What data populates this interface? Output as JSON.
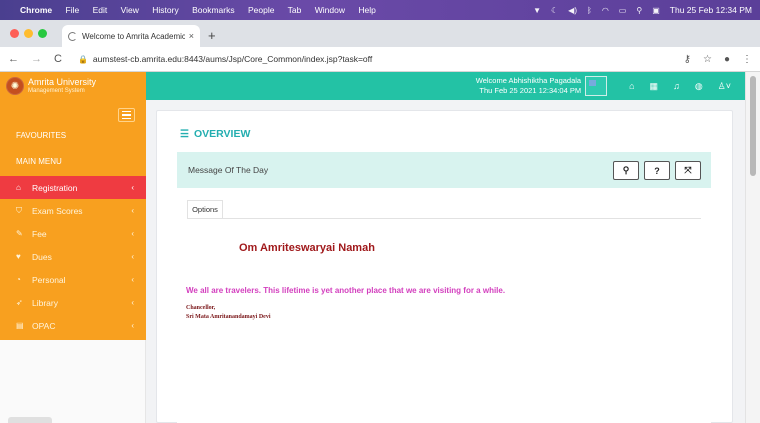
{
  "mac_menu": {
    "app": "Chrome",
    "items": [
      "File",
      "Edit",
      "View",
      "History",
      "Bookmarks",
      "People",
      "Tab",
      "Window",
      "Help"
    ],
    "clock": "Thu 25 Feb  12:34 PM"
  },
  "browser": {
    "tab_title": "Welcome to Amrita Academic I",
    "tab_close": "×",
    "new_tab": "+",
    "url": "aumstest-cb.amrita.edu:8443/aums/Jsp/Core_Common/index.jsp?task=off"
  },
  "app": {
    "logo_title": "Amrita University",
    "logo_subtitle": "Management System",
    "welcome_line": "Welcome Abhishiktha Pagadala",
    "datetime_line": "Thu Feb 25 2021 12:34:04 PM"
  },
  "sidebar": {
    "favourites": "FAVOURITES",
    "main_menu": "MAIN MENU",
    "items": [
      {
        "label": "Registration",
        "icon": "home-icon"
      },
      {
        "label": "Exam Scores",
        "icon": "cart-icon"
      },
      {
        "label": "Fee",
        "icon": "pencil-icon"
      },
      {
        "label": "Dues",
        "icon": "heart-icon"
      },
      {
        "label": "Personal",
        "icon": "clock-icon"
      },
      {
        "label": "Library",
        "icon": "send-icon"
      },
      {
        "label": "OPAC",
        "icon": "calendar-icon"
      }
    ]
  },
  "main": {
    "overview_title": "OVERVIEW",
    "panel_title": "Message Of The Day",
    "panel_buttons": {
      "link": "⚲",
      "help": "?",
      "expand": "⤧"
    },
    "options_tab": "Options",
    "om": "Om Amriteswaryai Namah",
    "quote": "We all are travelers. This lifetime is yet another place that we are visiting for a while.",
    "signature_title": "Chancellor,",
    "signature_name": "Sri Mata Amritanandamayi Devi"
  },
  "colors": {
    "header_teal": "#23c2a5",
    "sidebar_orange": "#f8a01f",
    "active_red": "#ef3b41",
    "overview_teal": "#23aeb0",
    "om_maroon": "#a0191b",
    "quote_magenta": "#d33fbe"
  }
}
